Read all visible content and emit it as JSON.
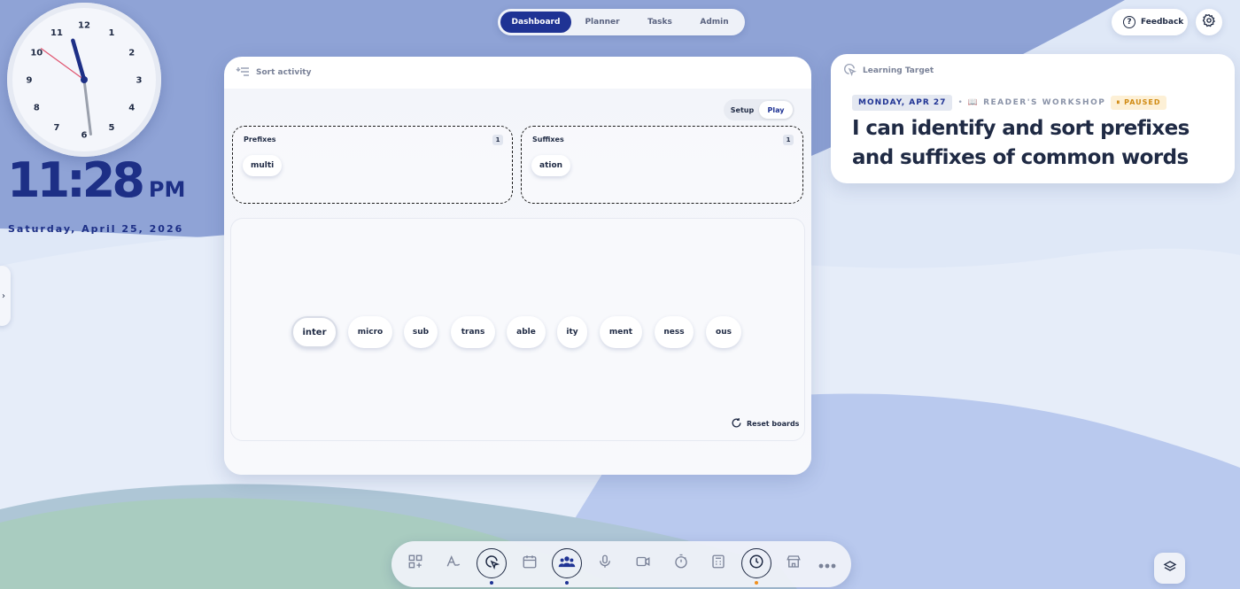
{
  "clock": {
    "hours": 11,
    "minutes": 28,
    "seconds": 51,
    "numerals": [
      "12",
      "1",
      "2",
      "3",
      "4",
      "5",
      "6",
      "7",
      "8",
      "9",
      "10",
      "11"
    ],
    "time_text": "11:28",
    "ampm": "PM",
    "date_text": "Saturday, April 25, 2026"
  },
  "nav": {
    "tabs": [
      {
        "label": "Dashboard",
        "active": true
      },
      {
        "label": "Planner",
        "active": false
      },
      {
        "label": "Tasks",
        "active": false
      },
      {
        "label": "Admin",
        "active": false
      }
    ]
  },
  "header_actions": {
    "feedback_label": "Feedback",
    "feedback_icon": "question-circle-icon",
    "settings_icon": "gear-icon"
  },
  "sort_activity": {
    "title": "Sort activity",
    "mode_options": [
      {
        "label": "Setup",
        "active": false
      },
      {
        "label": "Play",
        "active": true
      }
    ],
    "groups": [
      {
        "title": "Prefixes",
        "count": "1",
        "items": [
          "multi"
        ]
      },
      {
        "title": "Suffixes",
        "count": "1",
        "items": [
          "ation"
        ]
      }
    ],
    "pool": [
      "inter",
      "micro",
      "sub",
      "trans",
      "able",
      "ity",
      "ment",
      "ness",
      "ous"
    ],
    "reset_label": "Reset boards"
  },
  "learning_target": {
    "header": "Learning Target",
    "date": "MONDAY, APR 27",
    "separator": "•",
    "workshop": "📖 READER'S WORKSHOP",
    "status": "⏸ PAUSED",
    "statement": "I can identify and sort prefixes and suffixes of common words"
  },
  "dock": {
    "icons": [
      "widgets-add-icon",
      "handwriting-icon",
      "cursor-target-icon",
      "calendar-icon",
      "people-icon",
      "microphone-icon",
      "video-camera-icon",
      "stopwatch-icon",
      "calculator-icon",
      "clock-icon",
      "store-icon",
      "more-icon"
    ]
  },
  "colors": {
    "brand": "#1f3394",
    "clock_second_hand": "#e05570",
    "dock_dot_blue": "#1f3394",
    "dock_dot_orange": "#f0901e",
    "paused": "#d08a12"
  }
}
